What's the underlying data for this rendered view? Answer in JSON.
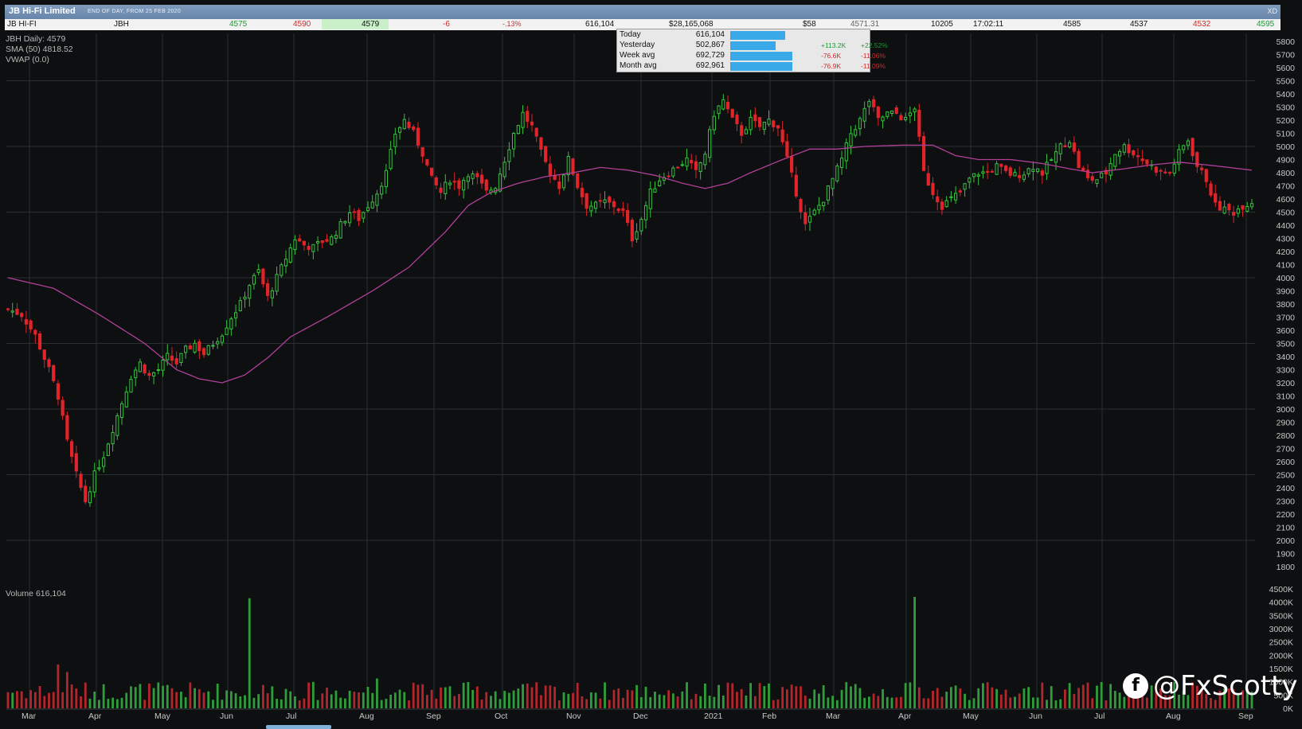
{
  "window": {
    "title": "JB Hi-Fi Limited",
    "subtitle": "END OF DAY, FROM 25 FEB 2020",
    "close_label": "XD"
  },
  "quote": {
    "name": "JB HI-FI",
    "code": "JBH",
    "bid": "4575",
    "ask": "4590",
    "last": "4579",
    "change": "-6",
    "change_pct": "-.13%",
    "volume": "616,104",
    "value": "$28,165,068",
    "vwap_partial": "$58",
    "avg_price": "4571.31",
    "trades": "10205",
    "time": "17:02:11",
    "open": "4585",
    "low": "4537",
    "prev": "4532",
    "high": "4595"
  },
  "volume_popup": {
    "rows": [
      {
        "label": "Today",
        "value": "616,104",
        "fill": 0.89,
        "chg_abs": "",
        "chg_pct": ""
      },
      {
        "label": "Yesterday",
        "value": "502,867",
        "fill": 0.73,
        "chg_abs": "+113.2K",
        "chg_pct": "+22.52%",
        "dir": "up"
      },
      {
        "label": "Week  avg",
        "value": "692,729",
        "fill": 1.0,
        "chg_abs": "-76.6K",
        "chg_pct": "-11.06%",
        "dir": "dn"
      },
      {
        "label": "Month avg",
        "value": "692,961",
        "fill": 1.0,
        "chg_abs": "-76.9K",
        "chg_pct": "-11.09%",
        "dir": "dn"
      }
    ]
  },
  "watermark": "@FxScotty",
  "colors": {
    "bg": "#0d0f10",
    "grid": "#2a2f33",
    "up": "#37c23f",
    "down": "#e0242a",
    "sma": "#b0409a",
    "axis_text": "#c8c8c8",
    "legend_text": "#b8b8b8",
    "vol_up": "#2f9e3a",
    "vol_down": "#b3262b"
  },
  "chart_data": {
    "type": "candlestick",
    "legend": [
      "JBH Daily: 4579",
      "SMA (50) 4818.52",
      "VWAP (0.0)"
    ],
    "price_axis": {
      "min": 1800,
      "max": 5800,
      "ticks": [
        1800,
        1900,
        2000,
        2100,
        2200,
        2300,
        2400,
        2500,
        2600,
        2700,
        2800,
        2900,
        3000,
        3100,
        3200,
        3300,
        3400,
        3500,
        3600,
        3700,
        3800,
        3900,
        4000,
        4100,
        4200,
        4300,
        4400,
        4500,
        4600,
        4700,
        4800,
        4900,
        5000,
        5100,
        5200,
        5300,
        5400,
        5500,
        5600,
        5700,
        5800
      ]
    },
    "volume_label": "Volume 616,104",
    "volume_axis": {
      "min": 0,
      "max": 4500,
      "unit": "K",
      "ticks": [
        "0K",
        "500K",
        "1000K",
        "1500K",
        "2000K",
        "2500K",
        "3000K",
        "3500K",
        "4000K",
        "4500K"
      ]
    },
    "months": [
      "Mar",
      "Apr",
      "May",
      "Jun",
      "Jul",
      "Aug",
      "Sep",
      "Oct",
      "Nov",
      "Dec",
      "2021",
      "Feb",
      "Mar",
      "Apr",
      "May",
      "Jun",
      "Jul",
      "Aug",
      "Sep"
    ],
    "close_path": [
      [
        0,
        3760
      ],
      [
        3,
        3720
      ],
      [
        6,
        3560
      ],
      [
        9,
        3300
      ],
      [
        11,
        3100
      ],
      [
        13,
        2750
      ],
      [
        15,
        2500
      ],
      [
        17,
        2300
      ],
      [
        19,
        2500
      ],
      [
        21,
        2650
      ],
      [
        23,
        2850
      ],
      [
        25,
        3050
      ],
      [
        27,
        3250
      ],
      [
        29,
        3350
      ],
      [
        31,
        3250
      ],
      [
        33,
        3300
      ],
      [
        35,
        3400
      ],
      [
        37,
        3350
      ],
      [
        39,
        3450
      ],
      [
        41,
        3500
      ],
      [
        43,
        3420
      ],
      [
        45,
        3500
      ],
      [
        47,
        3580
      ],
      [
        49,
        3700
      ],
      [
        51,
        3800
      ],
      [
        53,
        3950
      ],
      [
        55,
        4050
      ],
      [
        57,
        3850
      ],
      [
        59,
        4000
      ],
      [
        61,
        4150
      ],
      [
        63,
        4300
      ],
      [
        65,
        4250
      ],
      [
        67,
        4230
      ],
      [
        69,
        4280
      ],
      [
        71,
        4300
      ],
      [
        73,
        4400
      ],
      [
        75,
        4500
      ],
      [
        77,
        4450
      ],
      [
        79,
        4550
      ],
      [
        81,
        4650
      ],
      [
        83,
        4800
      ],
      [
        85,
        5100
      ],
      [
        87,
        5200
      ],
      [
        89,
        5100
      ],
      [
        91,
        4950
      ],
      [
        93,
        4750
      ],
      [
        95,
        4650
      ],
      [
        97,
        4750
      ],
      [
        99,
        4700
      ],
      [
        101,
        4800
      ],
      [
        103,
        4750
      ],
      [
        105,
        4650
      ],
      [
        107,
        4700
      ],
      [
        109,
        4900
      ],
      [
        111,
        5100
      ],
      [
        113,
        5250
      ],
      [
        115,
        5150
      ],
      [
        117,
        4950
      ],
      [
        119,
        4800
      ],
      [
        121,
        4700
      ],
      [
        123,
        4900
      ],
      [
        125,
        4700
      ],
      [
        127,
        4550
      ],
      [
        129,
        4550
      ],
      [
        131,
        4580
      ],
      [
        133,
        4550
      ],
      [
        135,
        4500
      ],
      [
        137,
        4300
      ],
      [
        139,
        4450
      ],
      [
        141,
        4650
      ],
      [
        143,
        4750
      ],
      [
        145,
        4800
      ],
      [
        147,
        4850
      ],
      [
        149,
        4900
      ],
      [
        151,
        4800
      ],
      [
        153,
        4950
      ],
      [
        155,
        5250
      ],
      [
        157,
        5350
      ],
      [
        159,
        5200
      ],
      [
        161,
        5100
      ],
      [
        163,
        5200
      ],
      [
        165,
        5150
      ],
      [
        167,
        5200
      ],
      [
        169,
        5150
      ],
      [
        171,
        4900
      ],
      [
        173,
        4650
      ],
      [
        175,
        4400
      ],
      [
        177,
        4500
      ],
      [
        179,
        4600
      ],
      [
        181,
        4750
      ],
      [
        183,
        4900
      ],
      [
        185,
        5100
      ],
      [
        187,
        5200
      ],
      [
        189,
        5350
      ],
      [
        191,
        5200
      ],
      [
        193,
        5250
      ],
      [
        195,
        5250
      ],
      [
        197,
        5200
      ],
      [
        199,
        5300
      ],
      [
        201,
        4800
      ],
      [
        203,
        4650
      ],
      [
        205,
        4550
      ],
      [
        207,
        4600
      ],
      [
        209,
        4650
      ],
      [
        211,
        4750
      ],
      [
        213,
        4800
      ],
      [
        215,
        4800
      ],
      [
        217,
        4850
      ],
      [
        219,
        4800
      ],
      [
        221,
        4780
      ],
      [
        223,
        4800
      ],
      [
        225,
        4850
      ],
      [
        227,
        4800
      ],
      [
        229,
        4900
      ],
      [
        231,
        5000
      ],
      [
        233,
        5050
      ],
      [
        235,
        4850
      ],
      [
        237,
        4750
      ],
      [
        239,
        4750
      ],
      [
        241,
        4800
      ],
      [
        243,
        4950
      ],
      [
        245,
        5000
      ],
      [
        247,
        4950
      ],
      [
        249,
        4900
      ],
      [
        251,
        4850
      ],
      [
        253,
        4800
      ],
      [
        255,
        4800
      ],
      [
        257,
        4950
      ],
      [
        259,
        5050
      ],
      [
        261,
        4850
      ],
      [
        263,
        4750
      ],
      [
        265,
        4550
      ],
      [
        267,
        4520
      ],
      [
        269,
        4500
      ],
      [
        271,
        4550
      ],
      [
        273,
        4579
      ]
    ],
    "sma_path": [
      [
        0,
        4000
      ],
      [
        10,
        3920
      ],
      [
        20,
        3720
      ],
      [
        30,
        3500
      ],
      [
        37,
        3300
      ],
      [
        42,
        3230
      ],
      [
        47,
        3200
      ],
      [
        52,
        3260
      ],
      [
        57,
        3390
      ],
      [
        62,
        3550
      ],
      [
        70,
        3700
      ],
      [
        80,
        3900
      ],
      [
        88,
        4080
      ],
      [
        96,
        4350
      ],
      [
        101,
        4550
      ],
      [
        106,
        4650
      ],
      [
        112,
        4720
      ],
      [
        118,
        4770
      ],
      [
        124,
        4800
      ],
      [
        130,
        4840
      ],
      [
        136,
        4820
      ],
      [
        142,
        4780
      ],
      [
        148,
        4720
      ],
      [
        153,
        4680
      ],
      [
        158,
        4720
      ],
      [
        163,
        4800
      ],
      [
        170,
        4900
      ],
      [
        176,
        4980
      ],
      [
        182,
        4980
      ],
      [
        188,
        5000
      ],
      [
        196,
        5010
      ],
      [
        203,
        5010
      ],
      [
        208,
        4930
      ],
      [
        213,
        4900
      ],
      [
        220,
        4900
      ],
      [
        227,
        4870
      ],
      [
        233,
        4830
      ],
      [
        238,
        4800
      ],
      [
        245,
        4830
      ],
      [
        251,
        4860
      ],
      [
        257,
        4880
      ],
      [
        263,
        4860
      ],
      [
        268,
        4840
      ],
      [
        273,
        4818.52
      ]
    ]
  }
}
